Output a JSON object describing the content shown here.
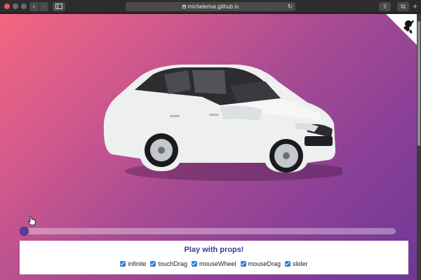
{
  "browser": {
    "url": "micheleriva.github.io",
    "back_glyph": "‹",
    "forward_glyph": "›",
    "reload_glyph": "↻",
    "share_glyph": "⇪",
    "tabs_glyph": "⧉",
    "new_tab_glyph": "+"
  },
  "carousel": {
    "image": "white-honda-civic-hatchback",
    "slider_value": 0
  },
  "props": {
    "title": "Play with props!",
    "options": [
      {
        "label": "infinite",
        "checked": true
      },
      {
        "label": "touchDrag",
        "checked": true
      },
      {
        "label": "mouseWheel",
        "checked": true
      },
      {
        "label": "mouseDrag",
        "checked": true
      },
      {
        "label": "slider",
        "checked": true
      }
    ]
  },
  "colors": {
    "gradient_start": "#f3667f",
    "gradient_end": "#6e3897",
    "checkbox": "#2f7bd9",
    "title": "#3c3a9a",
    "slider_thumb": "#5e3aa3"
  }
}
